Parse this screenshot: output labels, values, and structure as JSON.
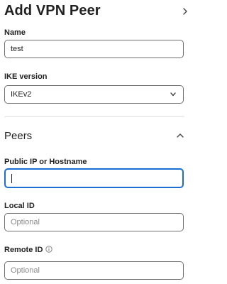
{
  "header": {
    "title": "Add VPN Peer"
  },
  "name_field": {
    "label": "Name",
    "value": "test"
  },
  "ike_field": {
    "label": "IKE version",
    "selected": "IKEv2"
  },
  "peers_section": {
    "title": "Peers"
  },
  "public_ip_field": {
    "label": "Public IP or Hostname",
    "value": ""
  },
  "local_id_field": {
    "label": "Local ID",
    "placeholder": "Optional"
  },
  "remote_id_field": {
    "label": "Remote ID",
    "placeholder": "Optional"
  },
  "icons": {
    "header_chevron": "chevron-right-icon",
    "select_chevron": "chevron-down-icon",
    "collapse_chevron": "chevron-up-icon",
    "info": "info-icon"
  },
  "colors": {
    "focus_border": "#1a6fd1",
    "field_border": "#6f6f6f",
    "text": "#212121",
    "placeholder": "#8a8a8a"
  }
}
